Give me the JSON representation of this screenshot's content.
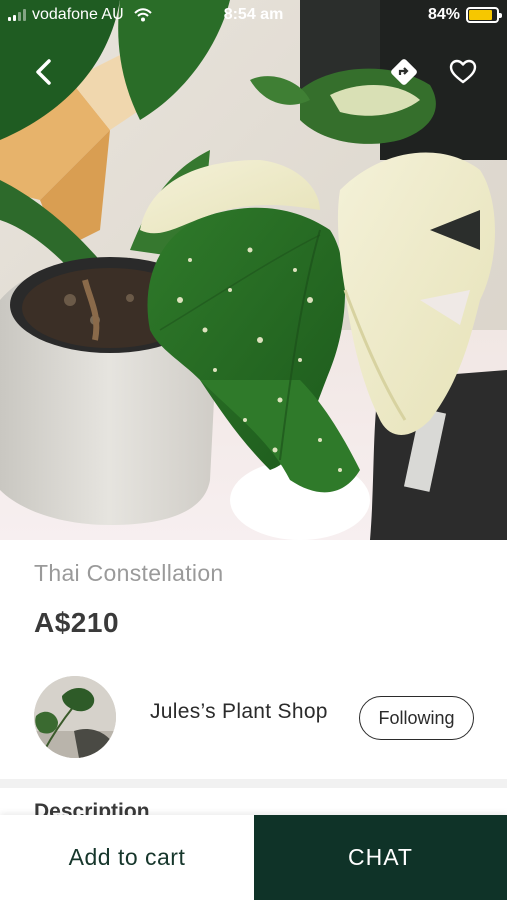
{
  "status_bar": {
    "carrier": "vodafone AU",
    "time": "8:54 am",
    "battery": "84%",
    "battery_level": 0.84
  },
  "nav": {
    "back_icon": "chevron-left-icon",
    "share_icon": "directions-icon",
    "favorite_icon": "heart-outline-icon"
  },
  "product": {
    "title": "Thai Constellation",
    "price": "A$210",
    "image": "variegated-monstera-plant-photo"
  },
  "seller": {
    "name": "Jules’s Plant Shop",
    "follow_label": "Following",
    "avatar": "monstera-leaf-avatar"
  },
  "description": {
    "heading": "Description"
  },
  "actions": {
    "add_to_cart_label": "Add to cart",
    "chat_label": "CHAT"
  },
  "colors": {
    "primary_dark_green": "#0f3328",
    "battery_yellow": "#f6c700",
    "title_grey": "#9a9a9a"
  }
}
